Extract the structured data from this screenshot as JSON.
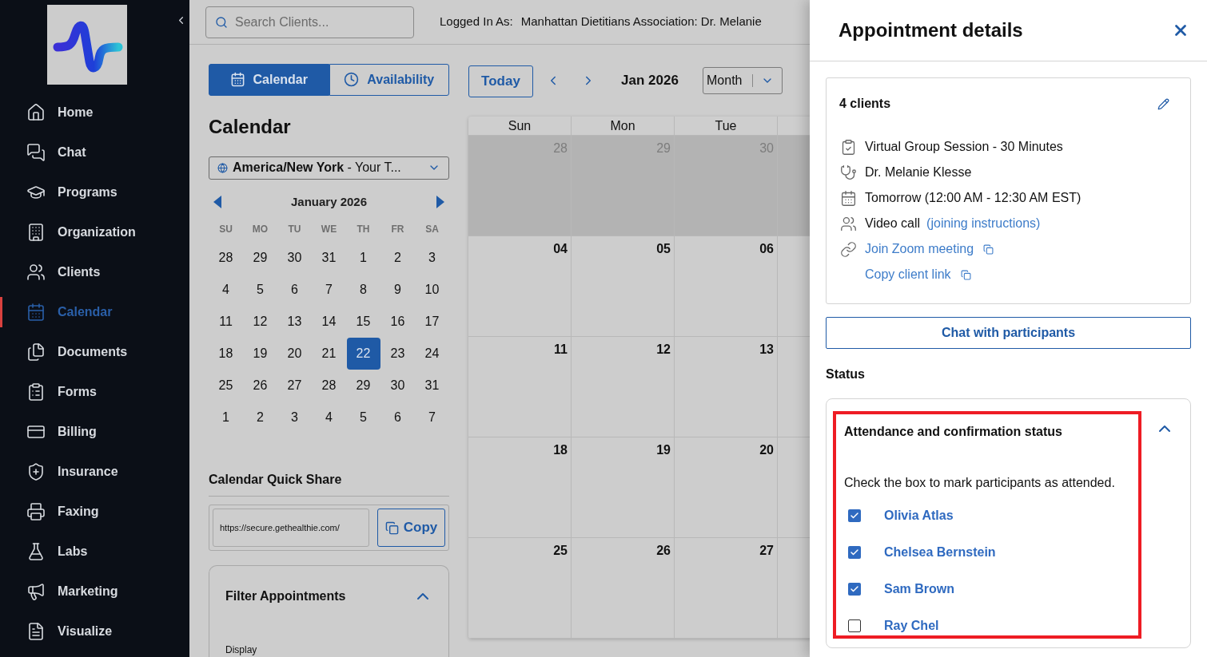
{
  "sidebar": {
    "items": [
      {
        "label": "Home",
        "selected": false
      },
      {
        "label": "Chat",
        "selected": false
      },
      {
        "label": "Programs",
        "selected": false
      },
      {
        "label": "Organization",
        "selected": false
      },
      {
        "label": "Clients",
        "selected": false
      },
      {
        "label": "Calendar",
        "selected": true
      },
      {
        "label": "Documents",
        "selected": false
      },
      {
        "label": "Forms",
        "selected": false
      },
      {
        "label": "Billing",
        "selected": false
      },
      {
        "label": "Insurance",
        "selected": false
      },
      {
        "label": "Faxing",
        "selected": false
      },
      {
        "label": "Labs",
        "selected": false
      },
      {
        "label": "Marketing",
        "selected": false
      },
      {
        "label": "Visualize",
        "selected": false
      }
    ]
  },
  "search": {
    "placeholder": "Search Clients..."
  },
  "logged_in": {
    "label": "Logged In As:",
    "value": "Manhattan Dietitians Association: Dr. Melanie"
  },
  "view_tabs": [
    {
      "label": "Calendar",
      "selected": true
    },
    {
      "label": "Availability",
      "selected": false
    }
  ],
  "toolbar": {
    "today": "Today",
    "period": "Jan 2026",
    "view_select": "Month"
  },
  "left": {
    "heading": "Calendar",
    "timezone": "**America/New York** - Your T...",
    "mini_calendar": {
      "title": "January 2026",
      "weekdays": [
        "SU",
        "MO",
        "TU",
        "WE",
        "TH",
        "FR",
        "SA"
      ],
      "weeks": [
        [
          {
            "day": "28",
            "selected": false
          },
          {
            "day": "29",
            "selected": false
          },
          {
            "day": "30",
            "selected": false
          },
          {
            "day": "31",
            "selected": false
          },
          {
            "day": "1",
            "selected": false
          },
          {
            "day": "2",
            "selected": false
          },
          {
            "day": "3",
            "selected": false
          }
        ],
        [
          {
            "day": "4",
            "selected": false
          },
          {
            "day": "5",
            "selected": false
          },
          {
            "day": "6",
            "selected": false
          },
          {
            "day": "7",
            "selected": false
          },
          {
            "day": "8",
            "selected": false
          },
          {
            "day": "9",
            "selected": false
          },
          {
            "day": "10",
            "selected": false
          }
        ],
        [
          {
            "day": "11",
            "selected": false
          },
          {
            "day": "12",
            "selected": false
          },
          {
            "day": "13",
            "selected": false
          },
          {
            "day": "14",
            "selected": false
          },
          {
            "day": "15",
            "selected": false
          },
          {
            "day": "16",
            "selected": false
          },
          {
            "day": "17",
            "selected": false
          }
        ],
        [
          {
            "day": "18",
            "selected": false
          },
          {
            "day": "19",
            "selected": false
          },
          {
            "day": "20",
            "selected": false
          },
          {
            "day": "21",
            "selected": false
          },
          {
            "day": "22",
            "selected": true
          },
          {
            "day": "23",
            "selected": false
          },
          {
            "day": "24",
            "selected": false
          }
        ],
        [
          {
            "day": "25",
            "selected": false
          },
          {
            "day": "26",
            "selected": false
          },
          {
            "day": "27",
            "selected": false
          },
          {
            "day": "28",
            "selected": false
          },
          {
            "day": "29",
            "selected": false
          },
          {
            "day": "30",
            "selected": false
          },
          {
            "day": "31",
            "selected": false
          }
        ],
        [
          {
            "day": "1",
            "selected": false
          },
          {
            "day": "2",
            "selected": false
          },
          {
            "day": "3",
            "selected": false
          },
          {
            "day": "4",
            "selected": false
          },
          {
            "day": "5",
            "selected": false
          },
          {
            "day": "6",
            "selected": false
          },
          {
            "day": "7",
            "selected": false
          }
        ]
      ]
    },
    "quick_share": {
      "title": "Calendar Quick Share",
      "url": "https://secure.gethealthie.com/",
      "copy": "Copy"
    },
    "filter": {
      "title": "Filter Appointments",
      "expanded": true,
      "display_label": "Display"
    }
  },
  "month_grid": {
    "columns": [
      "Sun",
      "Mon",
      "Tue"
    ],
    "weeks": [
      {
        "outside_month": true,
        "days": [
          "28",
          "29",
          "30"
        ]
      },
      {
        "outside_month": false,
        "days": [
          "04",
          "05",
          "06"
        ]
      },
      {
        "outside_month": false,
        "days": [
          "11",
          "12",
          "13"
        ]
      },
      {
        "outside_month": false,
        "days": [
          "18",
          "19",
          "20"
        ]
      },
      {
        "outside_month": false,
        "days": [
          "25",
          "26",
          "27"
        ]
      }
    ]
  },
  "panel": {
    "title": "Appointment details",
    "clients_count": "4 clients",
    "details": [
      {
        "kind": "text",
        "text": "Virtual Group Session - 30 Minutes"
      },
      {
        "kind": "text",
        "text": "Dr. Melanie Klesse"
      },
      {
        "kind": "text",
        "text": "Tomorrow (12:00 AM - 12:30 AM EST)"
      },
      {
        "kind": "text_link",
        "text": "Video call",
        "link": "(joining instructions)"
      },
      {
        "kind": "copy_link",
        "text": "Join Zoom meeting"
      },
      {
        "kind": "copy_link",
        "text": "Copy client link"
      }
    ],
    "chat_button": "Chat with participants",
    "status_label": "Status",
    "attendance": {
      "title": "Attendance and confirmation status",
      "expanded": true,
      "highlighted": true,
      "instruction": "Check the box to mark participants as attended.",
      "participants": [
        {
          "name": "Olivia Atlas",
          "checked": true
        },
        {
          "name": "Chelsea Bernstein",
          "checked": true
        },
        {
          "name": "Sam Brown",
          "checked": true
        },
        {
          "name": "Ray Chel",
          "checked": false
        }
      ]
    }
  }
}
